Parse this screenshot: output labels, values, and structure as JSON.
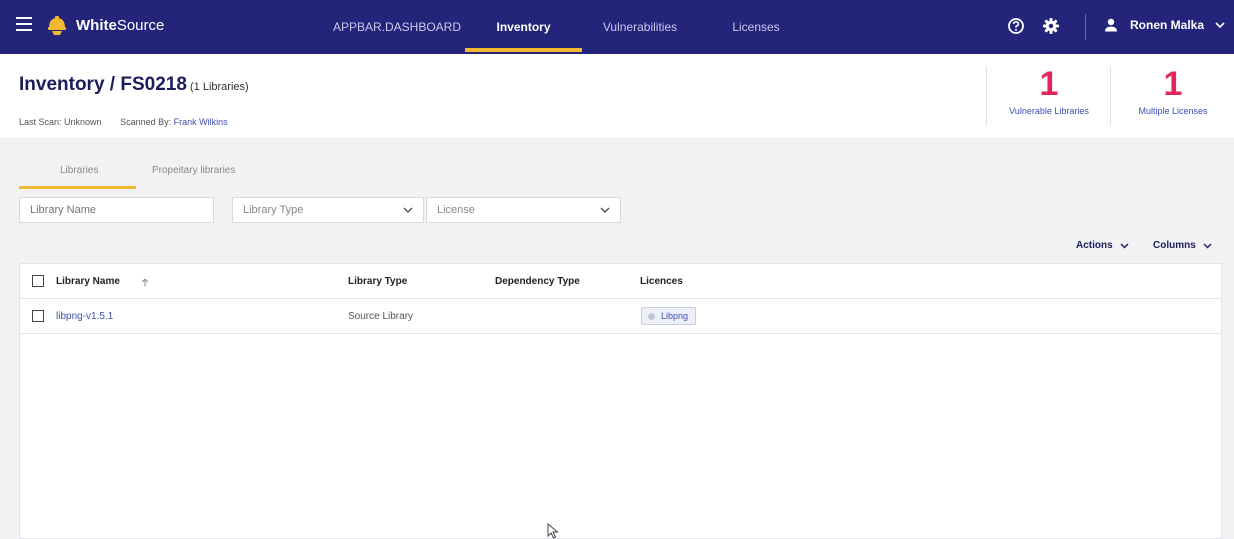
{
  "appbar": {
    "brand_bold": "White",
    "brand_rest": "Source",
    "nav": [
      "APPBAR.DASHBOARD",
      "Inventory",
      "Vulnerabilities",
      "Licenses"
    ],
    "active_nav": "Inventory",
    "user_name": "Ronen Malka",
    "icons": [
      "menu-icon",
      "whitesource-logo",
      "help-circle-icon",
      "gear-icon",
      "user-icon",
      "chevron-down-icon"
    ]
  },
  "header": {
    "title": "Inventory / FS0218",
    "count": "(1 Libraries)",
    "last_scan": "Last Scan: Unknown",
    "scanned_by_label": "Scanned By:",
    "scanned_by_name": "Frank Wilkins",
    "stats": [
      {
        "value": "1",
        "label": "Vulnerable Libraries"
      },
      {
        "value": "1",
        "label": "Multiple Licenses"
      }
    ]
  },
  "tabs": [
    "Libraries",
    "Propeitary libraries"
  ],
  "active_tab": "Libraries",
  "filters": {
    "library_name_placeholder": "Library Name",
    "library_type": "Library Type",
    "license": "License"
  },
  "table_actions": {
    "actions": "Actions",
    "columns": "Columns"
  },
  "table": {
    "columns": [
      "Library Name",
      "Library Type",
      "Dependency Type",
      "Licences"
    ],
    "rows": [
      {
        "name": "libpng-v1.5.1",
        "type": "Source Library",
        "dependency": "",
        "license": "Libpng"
      }
    ]
  },
  "colors": {
    "appbar": "#24247a",
    "accent": "#f2b830",
    "stat_number": "#e4245a",
    "link": "#3b4fb0"
  }
}
